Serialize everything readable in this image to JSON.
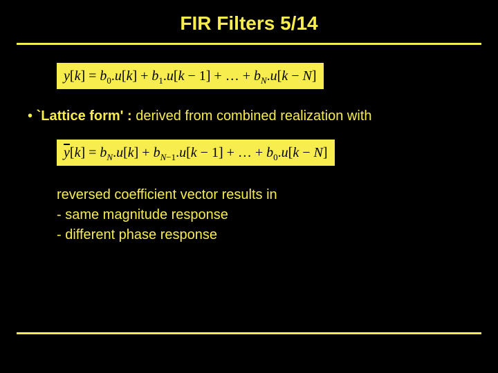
{
  "slide": {
    "title": "FIR Filters  5/14",
    "eq1_html": "<i>y</i>[<i>k</i>] = <i>b</i><sub>0</sub>.<i>u</i>[<i>k</i>] + <i>b</i><sub>1</sub>.<i>u</i>[<i>k</i> &minus; 1] + &hellip; + <i>b</i><sub><i>N</i></sub>.<i>u</i>[<i>k</i> &minus; <i>N</i>]",
    "bullet": {
      "marker": "•  ",
      "lead": "`Lattice form' :",
      "tail": " derived from combined realization with"
    },
    "eq2_html": "<span class=\"ybar\"><i>y</i></span>[<i>k</i>] = <i>b</i><sub><i>N</i></sub>.<i>u</i>[<i>k</i>] + <i>b</i><sub><i>N</i>&minus;1</sub>.<i>u</i>[<i>k</i> &minus; 1] + &hellip; + <i>b</i><sub>0</sub>.<i>u</i>[<i>k</i> &minus; <i>N</i>]",
    "body": {
      "line1": "reversed coefficient vector results in",
      "line2": "- same magnitude response",
      "line3": "- different phase response"
    }
  }
}
